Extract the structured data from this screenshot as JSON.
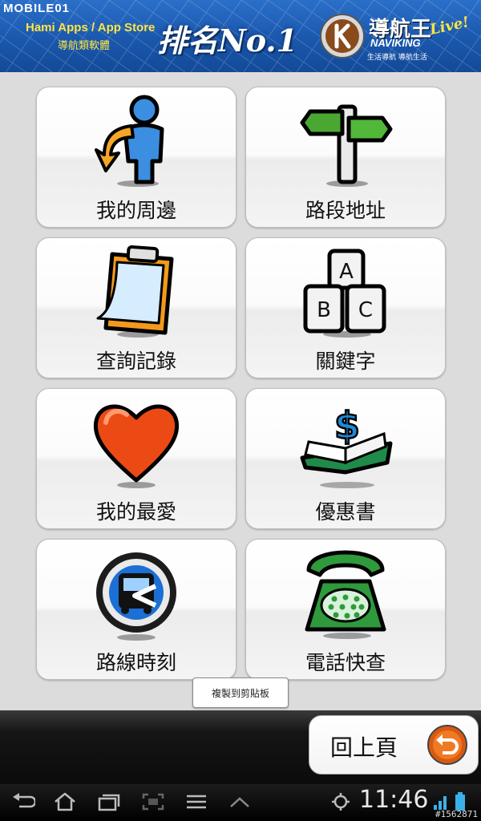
{
  "banner": {
    "site_logo": "MOBILE01",
    "line1": "Hami Apps / App Store",
    "line2": "導航類軟體",
    "rank": "排名No.1",
    "brand_name": "導航王",
    "brand_en": "NAVIKING",
    "brand_live": "Live!",
    "brand_slogan": "生活導航 導航生活"
  },
  "menu": {
    "items": [
      {
        "label": "我的周邊",
        "icon": "person-nearby-icon"
      },
      {
        "label": "路段地址",
        "icon": "signpost-icon"
      },
      {
        "label": "查詢記錄",
        "icon": "clipboard-icon"
      },
      {
        "label": "關鍵字",
        "icon": "abc-keys-icon"
      },
      {
        "label": "我的最愛",
        "icon": "heart-icon"
      },
      {
        "label": "優惠書",
        "icon": "dollar-book-icon"
      },
      {
        "label": "路線時刻",
        "icon": "bus-icon"
      },
      {
        "label": "電話快查",
        "icon": "telephone-icon"
      }
    ]
  },
  "toast": {
    "text": "複製到剪貼板"
  },
  "bottom": {
    "back_label": "回上頁",
    "back_icon": "return-arrow-icon"
  },
  "system": {
    "clock": "11:46",
    "buttons": [
      "back-icon",
      "home-icon",
      "recent-apps-icon",
      "screenshot-icon",
      "menu-icon",
      "up-arrow-icon"
    ],
    "watermark": "#1562871"
  },
  "colors": {
    "banner_blue": "#1a57ad",
    "banner_yellow": "#ffe640",
    "tile_bg": "#ffffff",
    "page_bg": "#dcdcdc"
  }
}
